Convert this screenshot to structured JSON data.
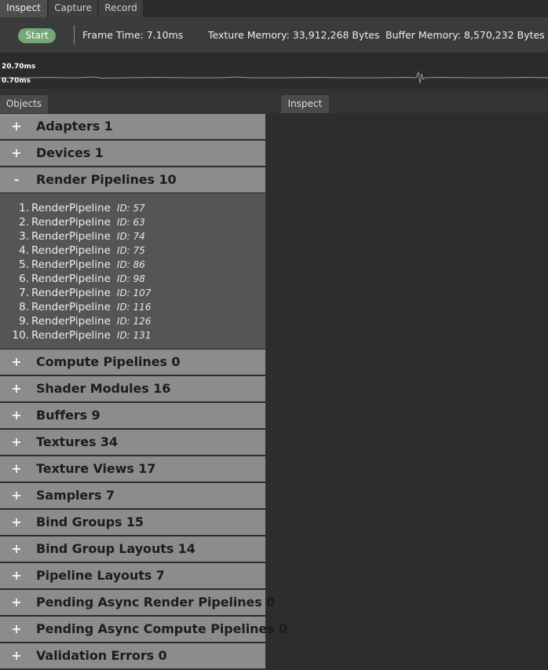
{
  "top_tabs": [
    {
      "label": "Inspect",
      "active": true
    },
    {
      "label": "Capture",
      "active": false
    },
    {
      "label": "Record",
      "active": false
    }
  ],
  "toolbar": {
    "start_label": "Start",
    "frame_time": "Frame Time: 7.10ms",
    "texture_memory": "Texture Memory: 33,912,268 Bytes",
    "buffer_memory": "Buffer Memory: 8,570,232 Bytes"
  },
  "graph": {
    "max_label": "20.70ms",
    "min_label": "0.70ms"
  },
  "panels": {
    "objects_tab": "Objects",
    "inspect_tab": "Inspect"
  },
  "groups": [
    {
      "sign": "+",
      "title": "Adapters 1"
    },
    {
      "sign": "+",
      "title": "Devices 1"
    },
    {
      "sign": "-",
      "title": "Render Pipelines 10"
    },
    {
      "sign": "+",
      "title": "Compute Pipelines 0"
    },
    {
      "sign": "+",
      "title": "Shader Modules 16"
    },
    {
      "sign": "+",
      "title": "Buffers 9"
    },
    {
      "sign": "+",
      "title": "Textures 34"
    },
    {
      "sign": "+",
      "title": "Texture Views 17"
    },
    {
      "sign": "+",
      "title": "Samplers 7"
    },
    {
      "sign": "+",
      "title": "Bind Groups 15"
    },
    {
      "sign": "+",
      "title": "Bind Group Layouts 14"
    },
    {
      "sign": "+",
      "title": "Pipeline Layouts 7"
    },
    {
      "sign": "+",
      "title": "Pending Async Render Pipelines 0"
    },
    {
      "sign": "+",
      "title": "Pending Async Compute Pipelines 0"
    },
    {
      "sign": "+",
      "title": "Validation Errors 0"
    }
  ],
  "render_pipelines": [
    {
      "num": "1.",
      "name": "RenderPipeline",
      "id": "ID: 57"
    },
    {
      "num": "2.",
      "name": "RenderPipeline",
      "id": "ID: 63"
    },
    {
      "num": "3.",
      "name": "RenderPipeline",
      "id": "ID: 74"
    },
    {
      "num": "4.",
      "name": "RenderPipeline",
      "id": "ID: 75"
    },
    {
      "num": "5.",
      "name": "RenderPipeline",
      "id": "ID: 86"
    },
    {
      "num": "6.",
      "name": "RenderPipeline",
      "id": "ID: 98"
    },
    {
      "num": "7.",
      "name": "RenderPipeline",
      "id": "ID: 107"
    },
    {
      "num": "8.",
      "name": "RenderPipeline",
      "id": "ID: 116"
    },
    {
      "num": "9.",
      "name": "RenderPipeline",
      "id": "ID: 126"
    },
    {
      "num": "10.",
      "name": "RenderPipeline",
      "id": "ID: 131"
    }
  ],
  "colors": {
    "start_button": "#76a779",
    "group_header": "#8c8c8c",
    "expanded_body": "#555555"
  }
}
